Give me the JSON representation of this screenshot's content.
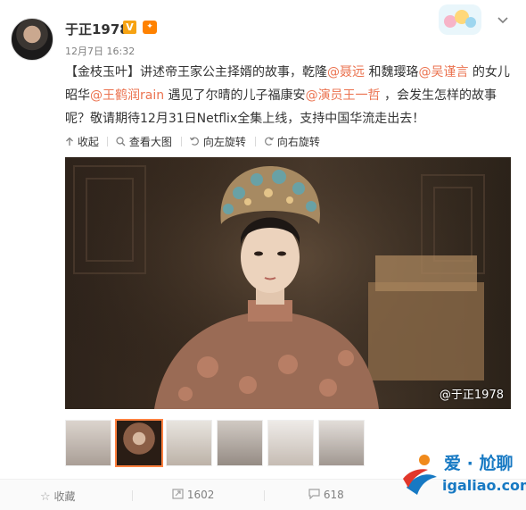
{
  "header": {
    "name": "于正1978",
    "verified_badge": "V",
    "time": "12月7日 16:32"
  },
  "post": {
    "p1": "【金枝玉叶】讲述帝王家公主择婿的故事，乾隆",
    "m1": "@聂远",
    "p2": " 和魏璎珞",
    "m2": "@吴谨言",
    "p3": " 的女儿昭华",
    "m3": "@王鹤润rain",
    "p4": " 遇见了尔晴的儿子福康安",
    "m4": "@演员王一哲",
    "p5": " ，会发生怎样的故事呢？敬请期待12月31日Netflix全集上线，支持中国华流走出去！"
  },
  "toolbar": {
    "collapse": "收起",
    "view_large": "查看大图",
    "rotate_left": "向左旋转",
    "rotate_right": "向右旋转"
  },
  "photo": {
    "watermark": "@于正1978"
  },
  "thumbnails": {
    "count": 6,
    "active_index": 1
  },
  "footer": {
    "favorite": "收藏",
    "repost_count": "1602",
    "comment_count": "618"
  },
  "brand": {
    "line1": "爱 · 尬聊",
    "line2": "igaliao.com"
  },
  "colors": {
    "mention": "#eb7350",
    "accent": "#ff8200",
    "brand": "#1779c3"
  },
  "icons": [
    "chevron-down-icon",
    "vip-icon",
    "collapse-arrow-icon",
    "zoom-icon",
    "rotate-left-icon",
    "rotate-right-icon",
    "favorite-star-icon",
    "repost-icon",
    "comment-icon"
  ]
}
